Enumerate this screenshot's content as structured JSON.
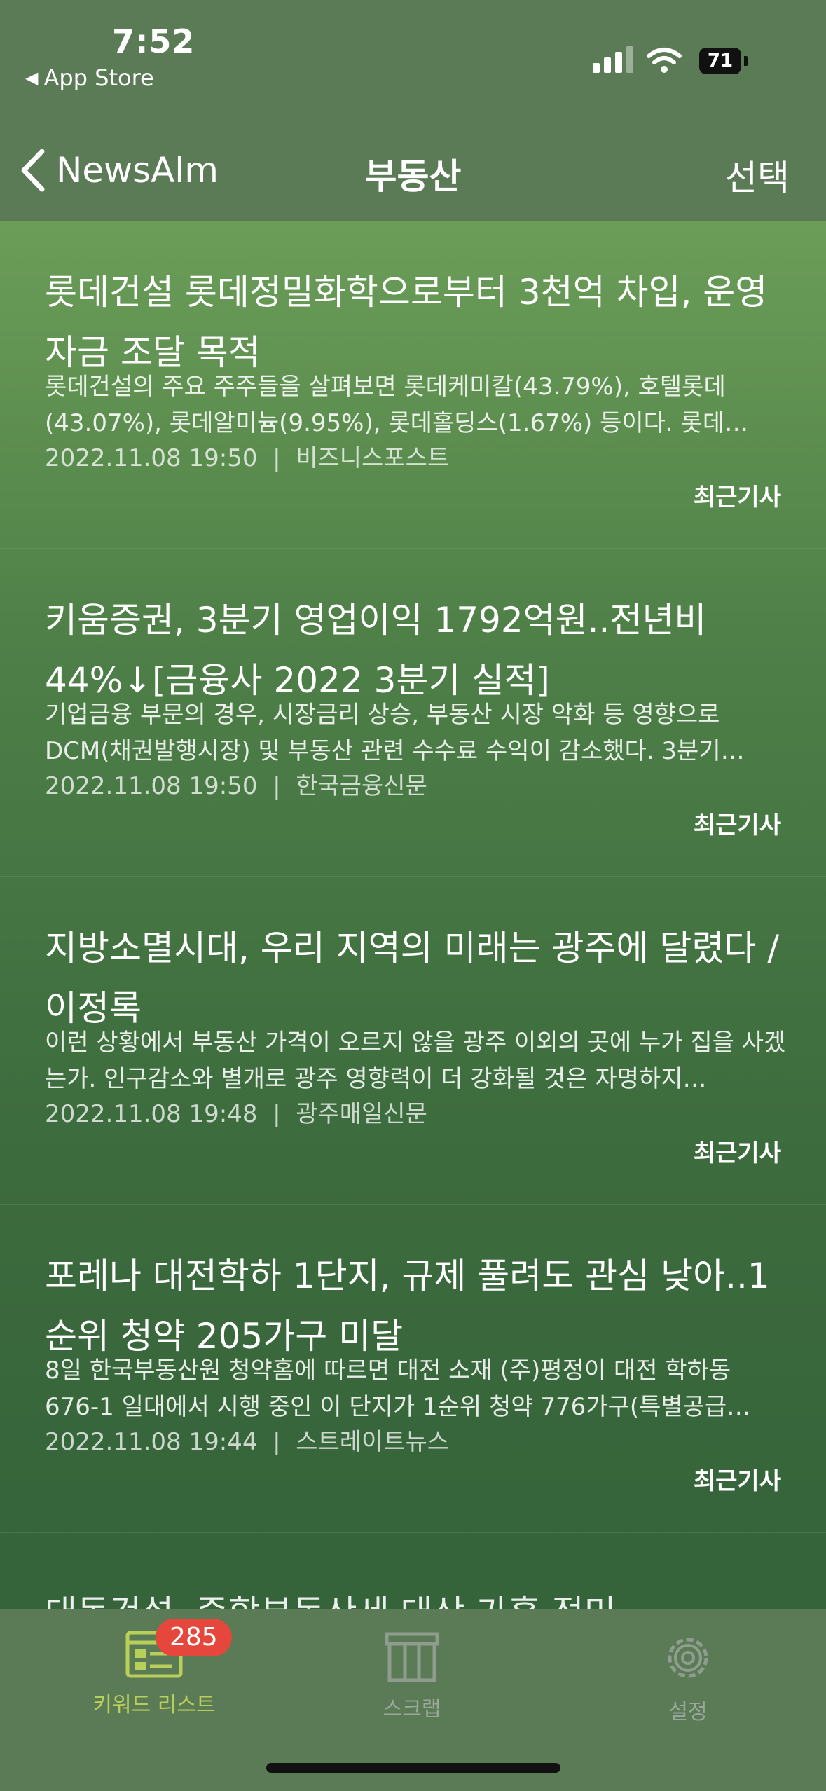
{
  "status_bar": {
    "time": "7:52",
    "back_app": "App Store",
    "battery": "71"
  },
  "nav": {
    "back_label": "NewsAlm",
    "title": "부동산",
    "select_label": "선택"
  },
  "articles": [
    {
      "title": "롯데건설 롯데정밀화학으로부터 3천억 차입, 운영자금 조달 목적",
      "summary": "롯데건설의 주요 주주들을 살펴보면 롯데케미칼(43.79%), 호텔롯데(43.07%), 롯데알미늄(9.95%), 롯데홀딩스(1.67%) 등이다. 롯데…",
      "date": "2022.11.08 19:50",
      "source": "비즈니스포스트",
      "tag": "최근기사"
    },
    {
      "title": "키움증권, 3분기 영업이익 1792억원..전년비 44%↓[금융사 2022 3분기 실적]",
      "summary": "기업금융 부문의 경우, 시장금리 상승, 부동산 시장 악화 등 영향으로 DCM(채권발행시장) 및 부동산 관련 수수료 수익이 감소했다. 3분기…",
      "date": "2022.11.08 19:50",
      "source": "한국금융신문",
      "tag": "최근기사"
    },
    {
      "title": "지방소멸시대, 우리 지역의 미래는 광주에 달렸다 / 이정록",
      "summary": "이런 상황에서 부동산 가격이 오르지 않을 광주 이외의 곳에 누가 집을 사겠는가. 인구감소와 별개로 광주 영향력이 더 강화될 것은 자명하지…",
      "date": "2022.11.08 19:48",
      "source": "광주매일신문",
      "tag": "최근기사"
    },
    {
      "title": "포레나 대전학하 1단지, 규제 풀려도 관심 낮아..1순위 청약 205가구 미달",
      "summary": "8일 한국부동산원 청약홈에 따르면 대전 소재 (주)평정이 대전 학하동 676-1 일대에서 시행 중인 이 단지가 1순위 청약 776가구(특별공급…",
      "date": "2022.11.08 19:44",
      "source": "스트레이트뉴스",
      "tag": "최근기사"
    }
  ],
  "separator": "|",
  "peek_title": "대동건설, 중합부동산세 대상 가혹 점미",
  "tabs": {
    "keywords": {
      "label": "키워드 리스트",
      "badge": "285",
      "icon": "list-browser-icon"
    },
    "scrap": {
      "label": "스크랩",
      "icon": "archive-box-icon"
    },
    "settings": {
      "label": "설정",
      "icon": "gear-icon"
    }
  },
  "colors": {
    "bar_background": "#5b7a56",
    "badge": "#e5473c",
    "active_tab": "#b8cf5a"
  }
}
